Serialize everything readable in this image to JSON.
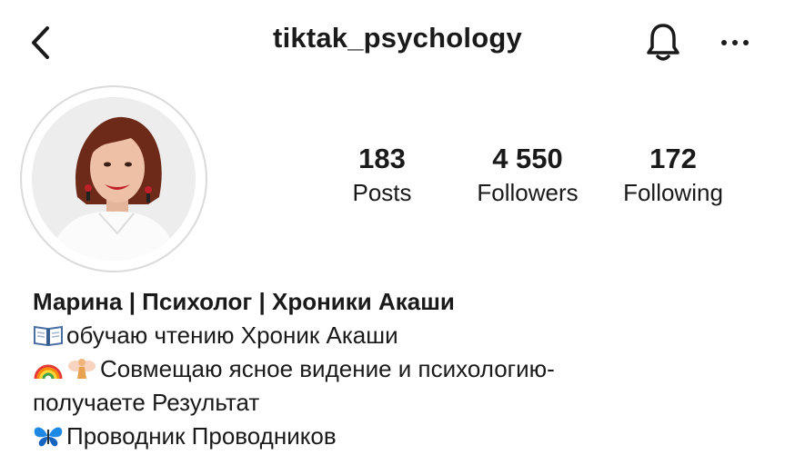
{
  "header": {
    "username": "tiktak_psychology",
    "back_icon": "chevron-left-icon",
    "bell_icon": "bell-icon",
    "more_icon": "more-horizontal-icon"
  },
  "profile": {
    "avatar_icon": "profile-photo",
    "stats": [
      {
        "value": "183",
        "label": "Posts"
      },
      {
        "value": "4 550",
        "label": "Followers"
      },
      {
        "value": "172",
        "label": "Following"
      }
    ],
    "bio": {
      "name": "Марина | Психолог | Хроники Акаши",
      "lines": [
        "обучаю чтению Хроник Акаши",
        "Совмещаю ясное видение и психологию-",
        "получаете Результат",
        "Проводник Проводников"
      ],
      "emoji": [
        "open-book",
        "rainbow",
        "fairy",
        "butterfly"
      ]
    }
  }
}
